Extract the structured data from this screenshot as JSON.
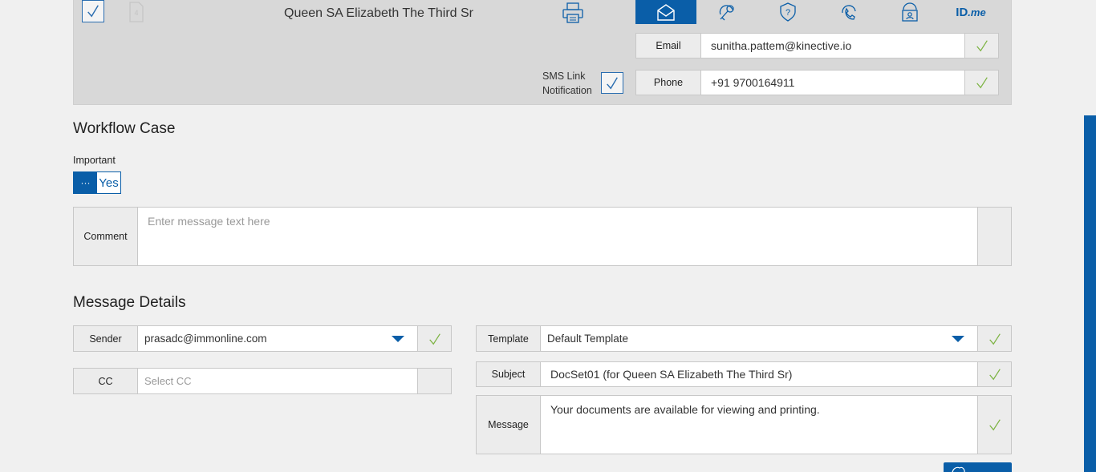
{
  "signer": {
    "name": "Queen SA Elizabeth The Third Sr",
    "order_badge": "4",
    "sms_label_line1": "SMS Link",
    "sms_label_line2": "Notification"
  },
  "auth_methods": [
    {
      "name": "email-auth-icon",
      "active": true
    },
    {
      "name": "key-auth-icon",
      "active": false
    },
    {
      "name": "question-shield-icon",
      "active": false
    },
    {
      "name": "phone-auth-icon",
      "active": false
    },
    {
      "name": "id-card-auth-icon",
      "active": false
    },
    {
      "name": "idme-logo",
      "active": false,
      "text_main": "ID",
      "text_suffix": ".me"
    }
  ],
  "contact": {
    "email_label": "Email",
    "email_value": "sunitha.pattem@kinective.io",
    "phone_label": "Phone",
    "phone_value": "+91 9700164911"
  },
  "workflow": {
    "title": "Workflow Case",
    "important_label": "Important",
    "toggle_knob": "···",
    "toggle_value": "Yes",
    "comment_label": "Comment",
    "comment_placeholder": "Enter message text here"
  },
  "message_details": {
    "title": "Message Details",
    "sender_label": "Sender",
    "sender_value": "prasadc@immonline.com",
    "cc_label": "CC",
    "cc_placeholder": "Select CC",
    "template_label": "Template",
    "template_value": "Default Template",
    "subject_label": "Subject",
    "subject_value": "DocSet01 (for Queen SA Elizabeth The Third Sr)",
    "message_label": "Message",
    "message_value": "Your documents are available for viewing and printing."
  },
  "colors": {
    "accent": "#0a5ea8",
    "check_green": "#7cb342",
    "panel_bg": "#d8d8d8",
    "page_bg": "#f0f0f0"
  }
}
